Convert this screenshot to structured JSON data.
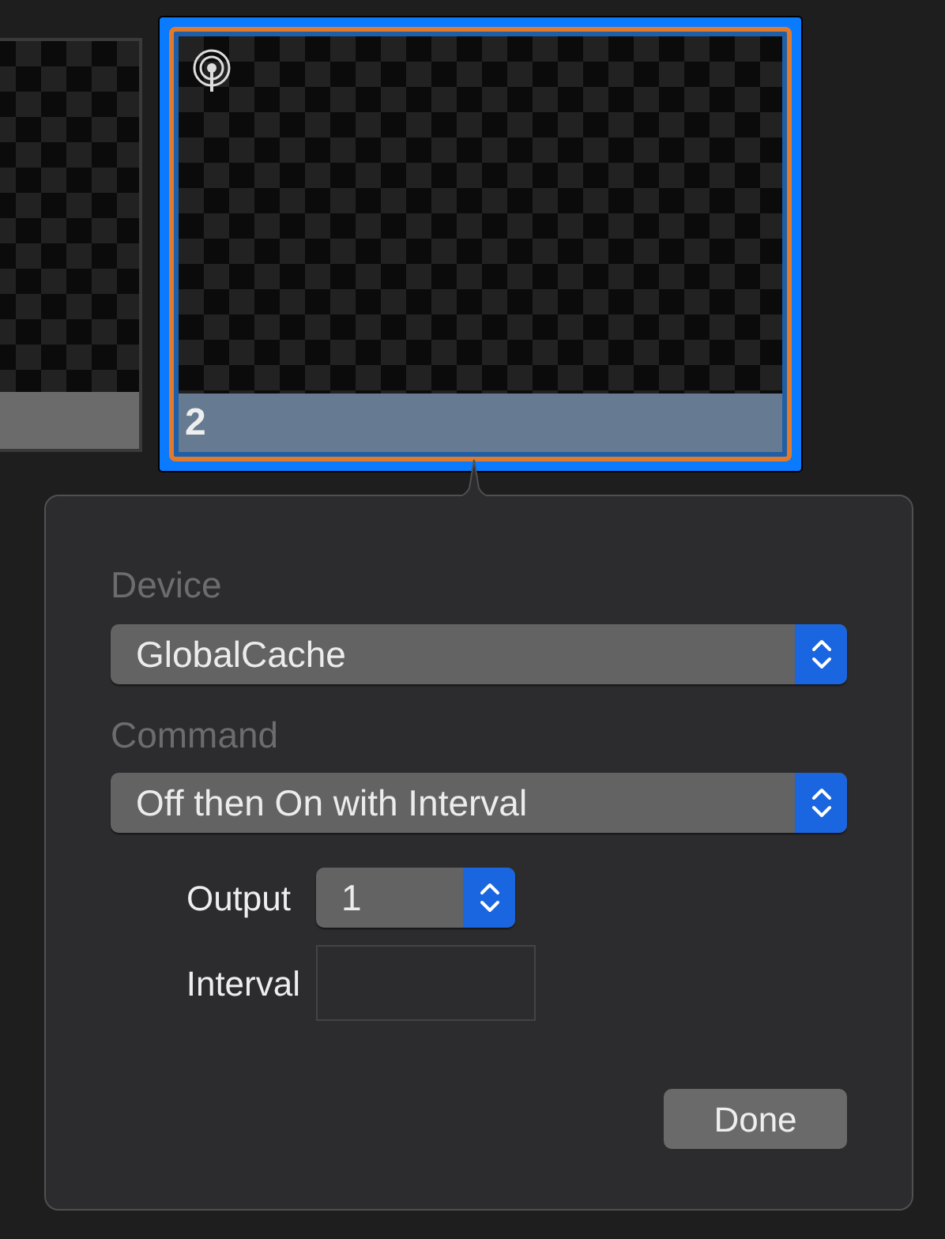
{
  "tiles": [
    {
      "selected": false
    },
    {
      "selected": true,
      "number": "2"
    }
  ],
  "popover": {
    "device": {
      "label": "Device",
      "value": "GlobalCache"
    },
    "command": {
      "label": "Command",
      "value": "Off then On with Interval"
    },
    "output": {
      "label": "Output",
      "value": "1"
    },
    "interval": {
      "label": "Interval"
    },
    "done_button": "Done"
  }
}
